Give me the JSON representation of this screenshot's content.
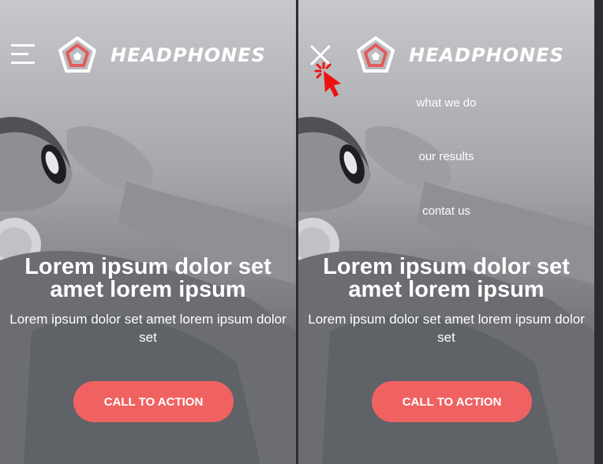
{
  "brand": {
    "name": "HEADPHONES"
  },
  "left": {
    "menu_icon": "hamburger-icon",
    "hero": {
      "title": "Lorem ipsum dolor set amet lorem ipsum",
      "subtitle": "Lorem ipsum dolor set amet lorem ipsum dolor set"
    },
    "cta_label": "CALL TO ACTION"
  },
  "right": {
    "menu_icon": "close-icon",
    "nav": [
      "what we do",
      "our results",
      "contat us"
    ],
    "hero": {
      "title": "Lorem ipsum dolor set amet lorem ipsum",
      "subtitle": "Lorem ipsum dolor set amet lorem ipsum dolor set"
    },
    "cta_label": "CALL TO ACTION"
  },
  "colors": {
    "accent": "#f06262",
    "logo_inner": "#e35b5b",
    "cursor": "#ee1111"
  }
}
